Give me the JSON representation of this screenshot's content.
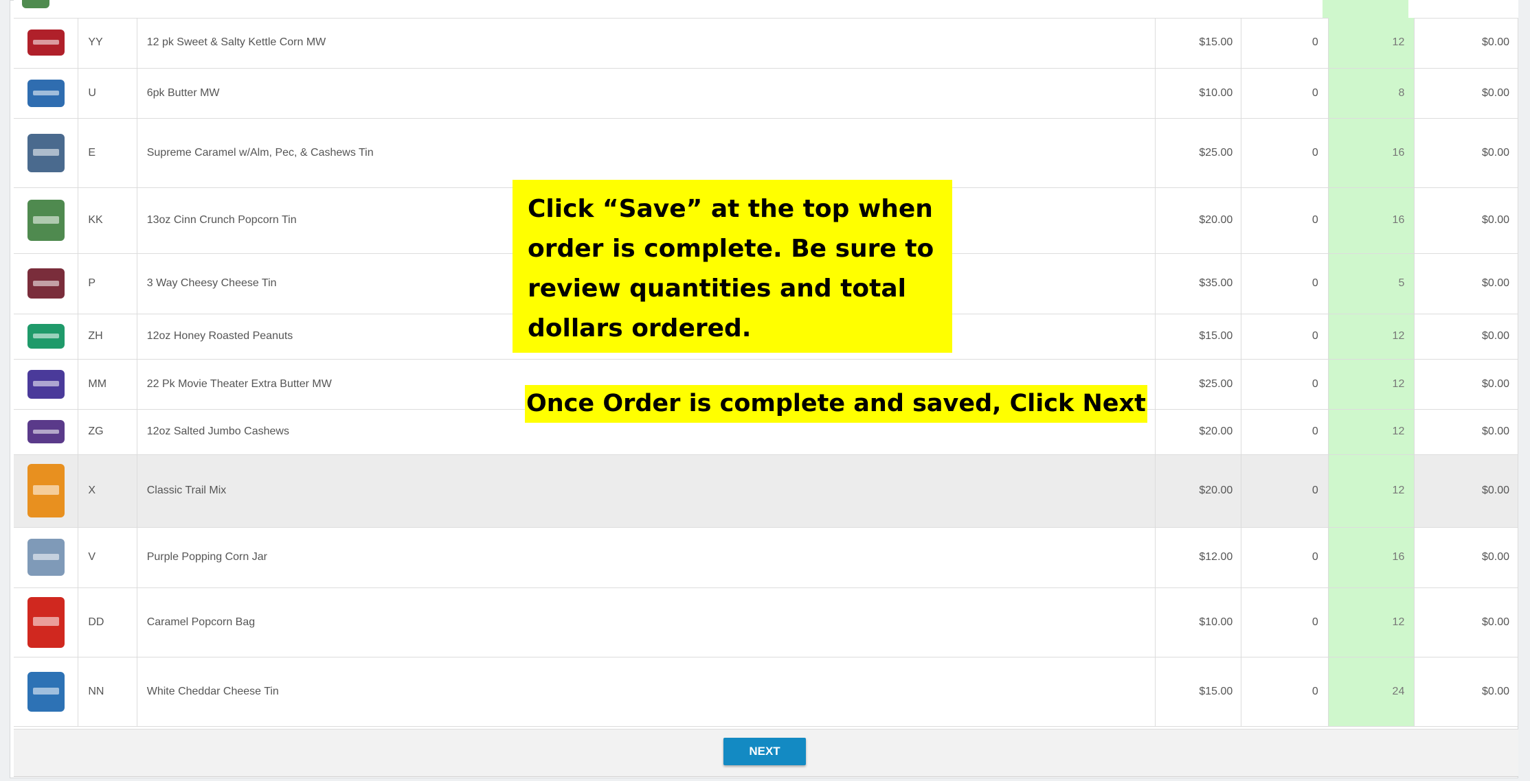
{
  "colors": {
    "min_column": "#cff7cc",
    "next_button": "#138ac3",
    "callout": "#ffff00"
  },
  "rows": [
    {
      "code": "YY",
      "name": "12 pk Sweet & Salty Kettle Corn MW",
      "price": "$15.00",
      "qty": "0",
      "min": "12",
      "total": "$0.00",
      "image_icon": "kettle-corn-box-icon"
    },
    {
      "code": "U",
      "name": "6pk Butter MW",
      "price": "$10.00",
      "qty": "0",
      "min": "8",
      "total": "$0.00",
      "image_icon": "butter-popcorn-box-icon"
    },
    {
      "code": "E",
      "name": "Supreme Caramel w/Alm, Pec, & Cashews Tin",
      "price": "$25.00",
      "qty": "0",
      "min": "16",
      "total": "$0.00",
      "image_icon": "caramel-tin-icon"
    },
    {
      "code": "KK",
      "name": "13oz Cinn Crunch Popcorn Tin",
      "price": "$20.00",
      "qty": "0",
      "min": "16",
      "total": "$0.00",
      "image_icon": "cinnamon-tin-icon"
    },
    {
      "code": "P",
      "name": "3 Way Cheesy Cheese Tin",
      "price": "$35.00",
      "qty": "0",
      "min": "5",
      "total": "$0.00",
      "image_icon": "cheese-tin-icon"
    },
    {
      "code": "ZH",
      "name": "12oz Honey Roasted Peanuts",
      "price": "$15.00",
      "qty": "0",
      "min": "12",
      "total": "$0.00",
      "image_icon": "peanuts-pouch-icon"
    },
    {
      "code": "MM",
      "name": "22 Pk Movie Theater Extra Butter MW",
      "price": "$25.00",
      "qty": "0",
      "min": "12",
      "total": "$0.00",
      "image_icon": "movie-theater-box-icon"
    },
    {
      "code": "ZG",
      "name": "12oz Salted Jumbo Cashews",
      "price": "$20.00",
      "qty": "0",
      "min": "12",
      "total": "$0.00",
      "image_icon": "cashews-pouch-icon"
    },
    {
      "code": "X",
      "name": "Classic Trail Mix",
      "price": "$20.00",
      "qty": "0",
      "min": "12",
      "total": "$0.00",
      "image_icon": "trail-mix-bag-icon"
    },
    {
      "code": "V",
      "name": "Purple Popping Corn Jar",
      "price": "$12.00",
      "qty": "0",
      "min": "16",
      "total": "$0.00",
      "image_icon": "popping-corn-jar-icon"
    },
    {
      "code": "DD",
      "name": "Caramel Popcorn Bag",
      "price": "$10.00",
      "qty": "0",
      "min": "12",
      "total": "$0.00",
      "image_icon": "caramel-popcorn-bag-icon"
    },
    {
      "code": "NN",
      "name": "White Cheddar Cheese Tin",
      "price": "$15.00",
      "qty": "0",
      "min": "24",
      "total": "$0.00",
      "image_icon": "white-cheddar-tin-icon"
    }
  ],
  "footer": {
    "next_label": "NEXT"
  },
  "callout": {
    "line1": "Click “Save” at the top when",
    "line2": "order is complete. Be sure to",
    "line3": "review quantities and total",
    "line4": "dollars ordered.",
    "instruction": "Once Order is complete and saved, Click  Next"
  }
}
